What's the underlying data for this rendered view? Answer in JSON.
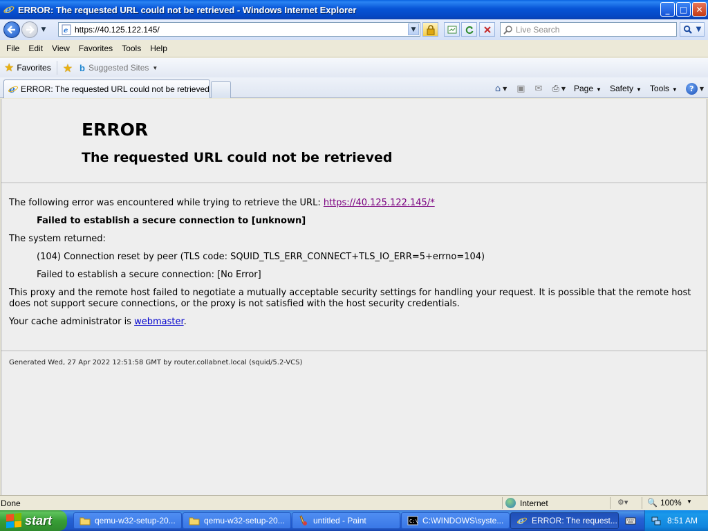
{
  "window": {
    "title": "ERROR: The requested URL could not be retrieved - Windows Internet Explorer",
    "buttons": {
      "minimize": "_",
      "maximize": "□",
      "close": "✕"
    }
  },
  "addressbar": {
    "url": "https://40.125.122.145/",
    "search_placeholder": "Live Search"
  },
  "menu": [
    "File",
    "Edit",
    "View",
    "Favorites",
    "Tools",
    "Help"
  ],
  "favorites_bar": {
    "favorites_label": "Favorites",
    "suggested_sites_label": "Suggested Sites"
  },
  "tab": {
    "label": "ERROR: The requested URL could not be retrieved"
  },
  "commandbar": {
    "page": "Page",
    "safety": "Safety",
    "tools": "Tools"
  },
  "page": {
    "heading": "ERROR",
    "subheading": "The requested URL could not be retrieved",
    "intro_text": "The following error was encountered while trying to retrieve the URL: ",
    "intro_link": "https://40.125.122.145/*",
    "error_title": "Failed to establish a secure connection to [unknown]",
    "system_returned": "The system returned:",
    "system_error_1": "(104) Connection reset by peer (TLS code: SQUID_TLS_ERR_CONNECT+TLS_IO_ERR=5+errno=104)",
    "system_error_2": "Failed to establish a secure connection: [No Error]",
    "explanation": "This proxy and the remote host failed to negotiate a mutually acceptable security settings for handling your request. It is possible that the remote host does not support secure connections, or the proxy is not satisfied with the host security credentials.",
    "admin_prefix": "Your cache administrator is ",
    "admin_link": "webmaster",
    "admin_suffix": ".",
    "footer": "Generated Wed, 27 Apr 2022 12:51:58 GMT by router.collabnet.local (squid/5.2-VCS)"
  },
  "statusbar": {
    "status": "Done",
    "zone": "Internet",
    "zoom": "100%"
  },
  "taskbar": {
    "start_label": "start",
    "items": [
      {
        "label": "qemu-w32-setup-20...",
        "icon": "folder-icon"
      },
      {
        "label": "qemu-w32-setup-20...",
        "icon": "folder-icon"
      },
      {
        "label": "untitled - Paint",
        "icon": "paint-icon"
      },
      {
        "label": "C:\\WINDOWS\\syste...",
        "icon": "cmd-icon"
      },
      {
        "label": "ERROR: The request...",
        "icon": "ie-icon"
      }
    ],
    "clock": "8:51 AM"
  },
  "colors": {
    "titlebar": "#0754d6",
    "link_visited": "#7a0080",
    "link": "#0000cc",
    "page_bg": "#eeeeee"
  }
}
